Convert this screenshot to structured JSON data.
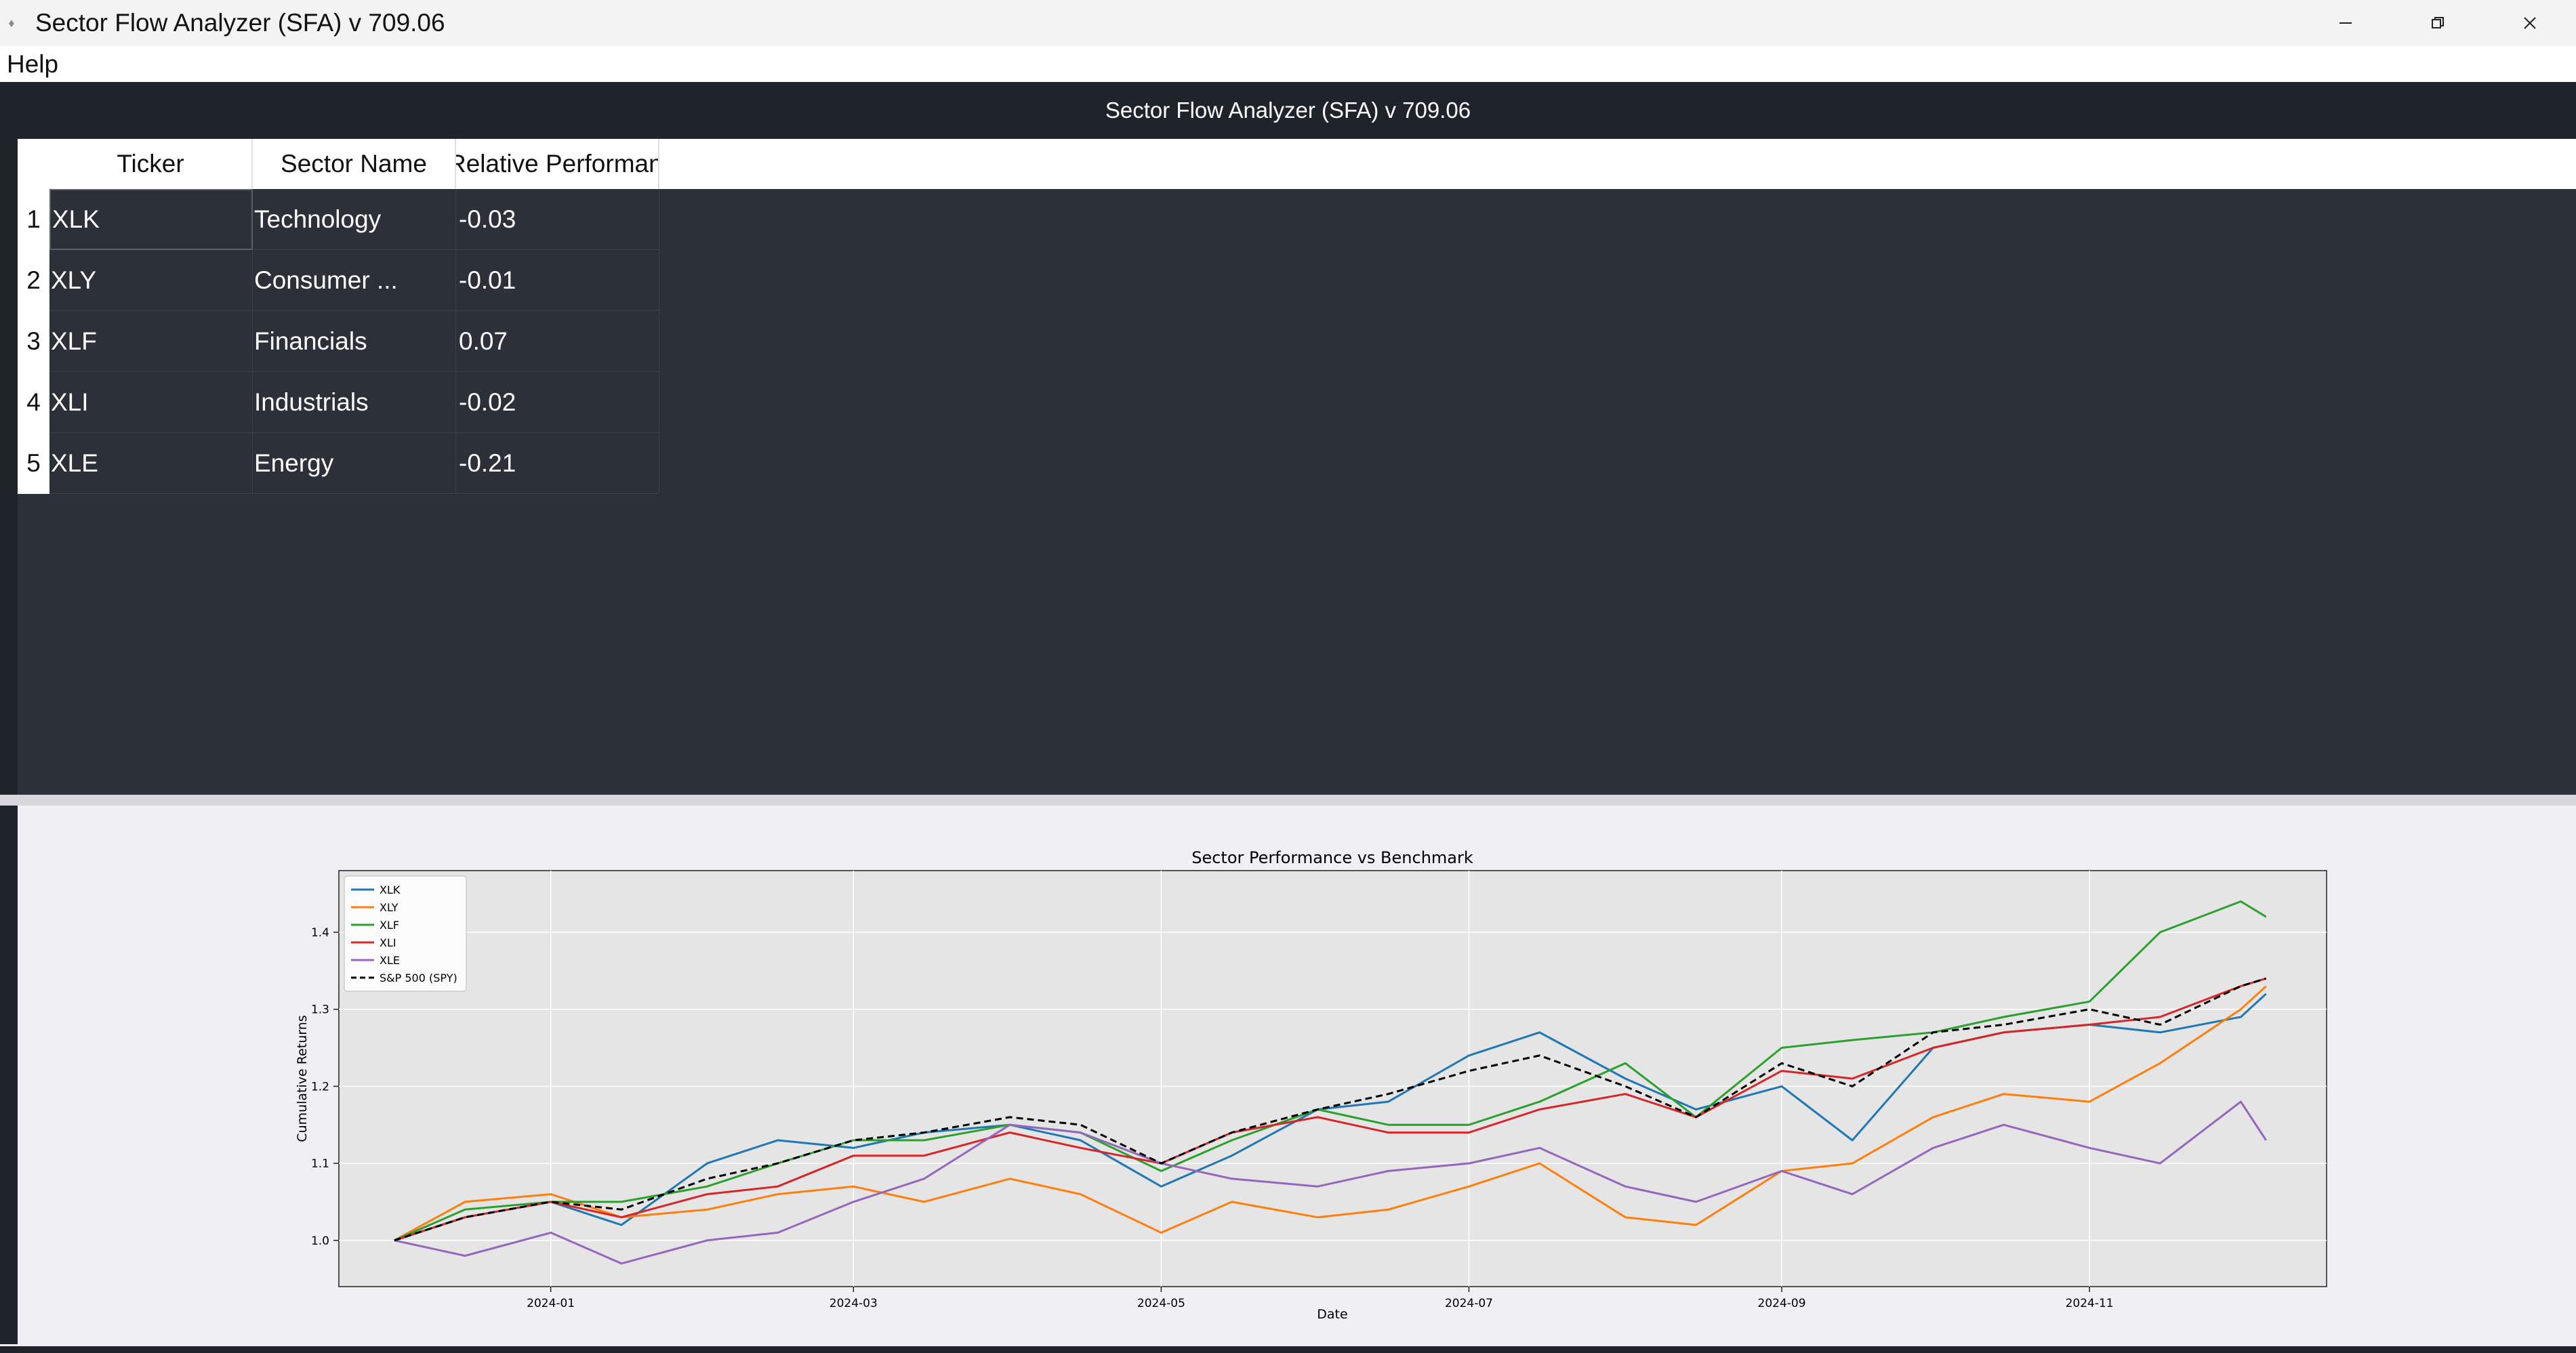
{
  "window": {
    "title": "Sector Flow Analyzer (SFA) v 709.06"
  },
  "menu": {
    "items": [
      "Help"
    ]
  },
  "header": {
    "title": "Sector Flow Analyzer (SFA) v 709.06"
  },
  "table": {
    "columns": [
      "Ticker",
      "Sector Name",
      "Relative Performance"
    ],
    "rows": [
      {
        "index": "1",
        "ticker": "XLK",
        "sector": "Technology",
        "perf": "-0.03"
      },
      {
        "index": "2",
        "ticker": "XLY",
        "sector": "Consumer ...",
        "perf": "-0.01"
      },
      {
        "index": "3",
        "ticker": "XLF",
        "sector": "Financials",
        "perf": "0.07"
      },
      {
        "index": "4",
        "ticker": "XLI",
        "sector": "Industrials",
        "perf": "-0.02"
      },
      {
        "index": "5",
        "ticker": "XLE",
        "sector": "Energy",
        "perf": "-0.21"
      }
    ]
  },
  "chart_data": {
    "type": "line",
    "title": "Sector Performance vs Benchmark",
    "xlabel": "Date",
    "ylabel": "Cumulative Returns",
    "xticks": [
      "2024-01",
      "2024-03",
      "2024-05",
      "2024-07",
      "2024-09",
      "2024-11"
    ],
    "yticks": [
      "1.0",
      "1.1",
      "1.2",
      "1.3",
      "1.4"
    ],
    "ylim": [
      0.94,
      1.48
    ],
    "grid": true,
    "legend_position": "top-left",
    "x": [
      "2023-12-01",
      "2023-12-15",
      "2024-01-01",
      "2024-01-15",
      "2024-02-01",
      "2024-02-15",
      "2024-03-01",
      "2024-03-15",
      "2024-04-01",
      "2024-04-15",
      "2024-05-01",
      "2024-05-15",
      "2024-06-01",
      "2024-06-15",
      "2024-07-01",
      "2024-07-15",
      "2024-08-01",
      "2024-08-15",
      "2024-09-01",
      "2024-09-15",
      "2024-10-01",
      "2024-10-15",
      "2024-11-01",
      "2024-11-15",
      "2024-12-01",
      "2024-12-06"
    ],
    "series": [
      {
        "name": "XLK",
        "color": "#1f77b4",
        "dash": false,
        "values": [
          1.0,
          1.03,
          1.05,
          1.02,
          1.1,
          1.13,
          1.12,
          1.14,
          1.15,
          1.13,
          1.07,
          1.11,
          1.17,
          1.18,
          1.24,
          1.27,
          1.21,
          1.17,
          1.2,
          1.13,
          1.25,
          1.27,
          1.28,
          1.27,
          1.29,
          1.32
        ]
      },
      {
        "name": "XLY",
        "color": "#ff7f0e",
        "dash": false,
        "values": [
          1.0,
          1.05,
          1.06,
          1.03,
          1.04,
          1.06,
          1.07,
          1.05,
          1.08,
          1.06,
          1.01,
          1.05,
          1.03,
          1.04,
          1.07,
          1.1,
          1.03,
          1.02,
          1.09,
          1.1,
          1.16,
          1.19,
          1.18,
          1.23,
          1.3,
          1.33
        ]
      },
      {
        "name": "XLF",
        "color": "#2ca02c",
        "dash": false,
        "values": [
          1.0,
          1.04,
          1.05,
          1.05,
          1.07,
          1.1,
          1.13,
          1.13,
          1.15,
          1.14,
          1.09,
          1.13,
          1.17,
          1.15,
          1.15,
          1.18,
          1.23,
          1.16,
          1.25,
          1.26,
          1.27,
          1.29,
          1.31,
          1.4,
          1.44,
          1.42
        ]
      },
      {
        "name": "XLI",
        "color": "#d62728",
        "dash": false,
        "values": [
          1.0,
          1.03,
          1.05,
          1.03,
          1.06,
          1.07,
          1.11,
          1.11,
          1.14,
          1.12,
          1.1,
          1.14,
          1.16,
          1.14,
          1.14,
          1.17,
          1.19,
          1.16,
          1.22,
          1.21,
          1.25,
          1.27,
          1.28,
          1.29,
          1.33,
          1.34
        ]
      },
      {
        "name": "XLE",
        "color": "#9467bd",
        "dash": false,
        "values": [
          1.0,
          0.98,
          1.01,
          0.97,
          1.0,
          1.01,
          1.05,
          1.08,
          1.15,
          1.14,
          1.1,
          1.08,
          1.07,
          1.09,
          1.1,
          1.12,
          1.07,
          1.05,
          1.09,
          1.06,
          1.12,
          1.15,
          1.12,
          1.1,
          1.18,
          1.13
        ]
      },
      {
        "name": "S&P 500 (SPY)",
        "color": "#000000",
        "dash": true,
        "values": [
          1.0,
          1.03,
          1.05,
          1.04,
          1.08,
          1.1,
          1.13,
          1.14,
          1.16,
          1.15,
          1.1,
          1.14,
          1.17,
          1.19,
          1.22,
          1.24,
          1.2,
          1.16,
          1.23,
          1.2,
          1.27,
          1.28,
          1.3,
          1.28,
          1.33,
          1.34
        ]
      }
    ]
  }
}
